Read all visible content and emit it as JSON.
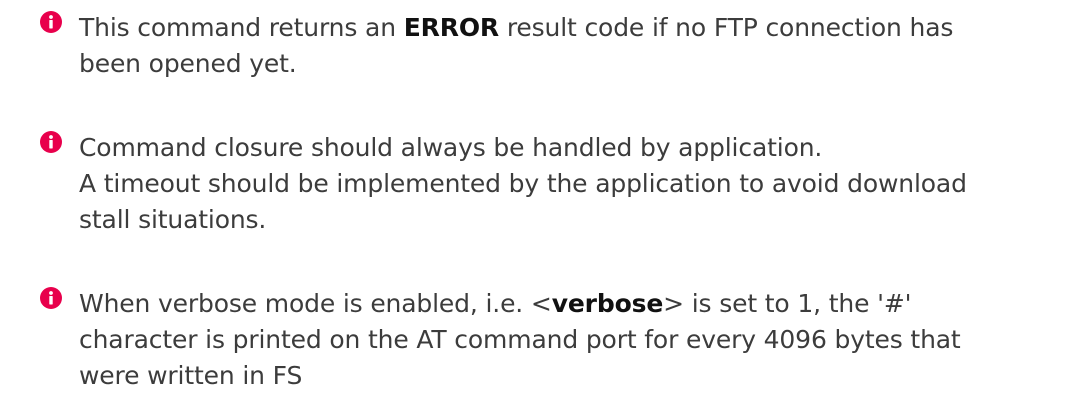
{
  "icon": {
    "name": "info-icon",
    "glyph": "i",
    "color": "#e8004c"
  },
  "notes": [
    {
      "lines": [
        {
          "pre": "This command returns an ",
          "em": "ERROR",
          "post": " result code if no FTP connection has"
        },
        {
          "pre": "been opened yet.",
          "em": "",
          "post": ""
        }
      ]
    },
    {
      "lines": [
        {
          "pre": "Command closure should always be handled by application.",
          "em": "",
          "post": ""
        },
        {
          "pre": "A timeout should be implemented by the application to avoid download",
          "em": "",
          "post": ""
        },
        {
          "pre": "stall situations.",
          "em": "",
          "post": ""
        }
      ]
    },
    {
      "lines": [
        {
          "pre": "When verbose mode is enabled, i.e. <",
          "em": "verbose",
          "post": "> is set to 1, the '#'"
        },
        {
          "pre": "character is printed on the AT command port for every 4096 bytes that",
          "em": "",
          "post": ""
        },
        {
          "pre": "were written in FS",
          "em": "",
          "post": ""
        }
      ]
    }
  ]
}
